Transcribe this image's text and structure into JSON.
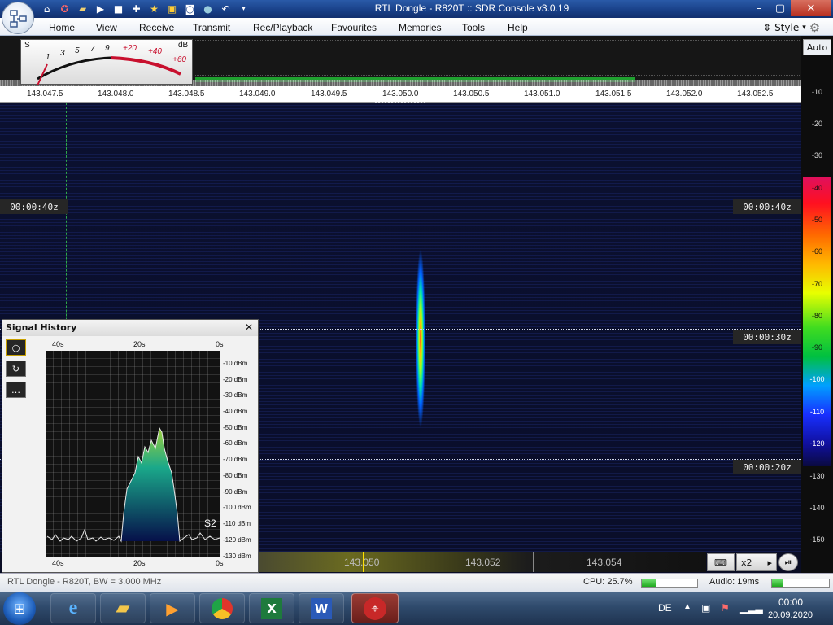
{
  "window": {
    "title": "RTL Dongle - R820T :: SDR Console v3.0.19"
  },
  "menu": {
    "items": [
      "Home",
      "View",
      "Receive",
      "Transmit",
      "Rec/Playback",
      "Favourites",
      "Memories",
      "Tools",
      "Help"
    ],
    "style_label": "Style"
  },
  "smeter": {
    "unit_s": "S",
    "unit_db": "dB",
    "s_labels": [
      "1",
      "3",
      "5",
      "7",
      "9"
    ],
    "db_labels": [
      "+20",
      "+40",
      "+60"
    ]
  },
  "spectrum": {
    "freq_labels": [
      "143.047.5",
      "143.048.0",
      "143.048.5",
      "143.049.0",
      "143.049.5",
      "143.050.0",
      "143.050.5",
      "143.051.0",
      "143.051.5",
      "143.052.0",
      "143.052.5"
    ]
  },
  "right_scale": {
    "auto_label": "Auto",
    "db_top": [
      "-10",
      "-20",
      "-30"
    ],
    "db_color": [
      "-40",
      "-50",
      "-60",
      "-70",
      "-80",
      "-90",
      "-100",
      "-110",
      "-120"
    ],
    "db_bottom": [
      "-130",
      "-140",
      "-150"
    ]
  },
  "waterfall": {
    "timestamps": [
      "00:00:40z",
      "00:00:30z",
      "00:00:20z"
    ]
  },
  "freq_bar": {
    "labels": [
      "143.050",
      "143.052",
      "143.054"
    ],
    "zoom_label": "x2"
  },
  "signal_history": {
    "title": "Signal History",
    "x_top": [
      "40s",
      "20s",
      "0s"
    ],
    "x_bottom": [
      "40s",
      "20s",
      "0s"
    ],
    "y_labels": [
      "-10 dBm",
      "-20 dBm",
      "-30 dBm",
      "-40 dBm",
      "-50 dBm",
      "-60 dBm",
      "-70 dBm",
      "-80 dBm",
      "-90 dBm",
      "-100 dBm",
      "-110 dBm",
      "-120 dBm",
      "-130 dBm"
    ],
    "s_label": "S2"
  },
  "status": {
    "device": "RTL Dongle - R820T, BW = 3.000 MHz",
    "cpu": "CPU: 25.7%",
    "cpu_pct": 25.7,
    "audio": "Audio: 19ms",
    "audio_level": 0.2
  },
  "taskbar": {
    "lang": "DE",
    "time": "00:00",
    "date": "20.09.2020"
  },
  "colors": {
    "accent": "#1f3f86",
    "waterfall_bg": "#0a0e2a",
    "grid": "#2ea84a"
  }
}
